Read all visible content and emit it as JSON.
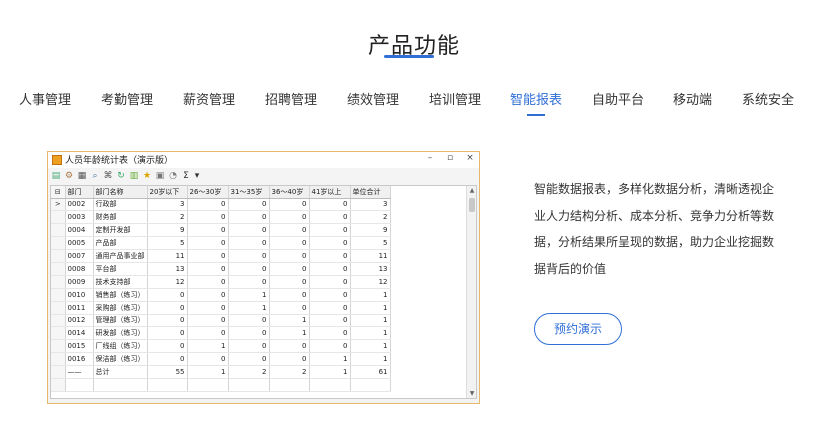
{
  "section": {
    "title": "产品功能"
  },
  "tabs": [
    {
      "label": "人事管理",
      "active": false
    },
    {
      "label": "考勤管理",
      "active": false
    },
    {
      "label": "薪资管理",
      "active": false
    },
    {
      "label": "招聘管理",
      "active": false
    },
    {
      "label": "绩效管理",
      "active": false
    },
    {
      "label": "培训管理",
      "active": false
    },
    {
      "label": "智能报表",
      "active": true
    },
    {
      "label": "自助平台",
      "active": false
    },
    {
      "label": "移动端",
      "active": false
    },
    {
      "label": "系统安全",
      "active": false
    }
  ],
  "window": {
    "title": "人员年龄统计表（演示版）",
    "controls": {
      "minimize": "–",
      "maximize": "▫",
      "close": "×"
    },
    "toolbar_icons": [
      "print-preview-icon",
      "setup-icon",
      "print-icon",
      "search-icon",
      "find-icon",
      "refresh-icon",
      "export-icon",
      "star-icon",
      "save-icon",
      "chat-icon",
      "sigma-icon",
      "dropdown-icon"
    ],
    "grid": {
      "columns": [
        "",
        "部门",
        "部门名称",
        "20岁以下",
        "26～30岁",
        "31～35岁",
        "36～40岁",
        "41岁以上",
        "单位合计"
      ],
      "header_indicator": "⊟",
      "rows": [
        {
          "ind": ">",
          "code": "0002",
          "name": "行政部",
          "v": [
            "3",
            "0",
            "0",
            "0",
            "0",
            "3"
          ]
        },
        {
          "ind": "",
          "code": "0003",
          "name": "财务部",
          "v": [
            "2",
            "0",
            "0",
            "0",
            "0",
            "2"
          ]
        },
        {
          "ind": "",
          "code": "0004",
          "name": "定制开发部",
          "v": [
            "9",
            "0",
            "0",
            "0",
            "0",
            "9"
          ]
        },
        {
          "ind": "",
          "code": "0005",
          "name": "产品部",
          "v": [
            "5",
            "0",
            "0",
            "0",
            "0",
            "5"
          ]
        },
        {
          "ind": "",
          "code": "0007",
          "name": "通用产品事业部",
          "v": [
            "11",
            "0",
            "0",
            "0",
            "0",
            "11"
          ]
        },
        {
          "ind": "",
          "code": "0008",
          "name": "平台部",
          "v": [
            "13",
            "0",
            "0",
            "0",
            "0",
            "13"
          ]
        },
        {
          "ind": "",
          "code": "0009",
          "name": "技术支持部",
          "v": [
            "12",
            "0",
            "0",
            "0",
            "0",
            "12"
          ]
        },
        {
          "ind": "",
          "code": "0010",
          "name": "销售部（练习）",
          "v": [
            "0",
            "0",
            "1",
            "0",
            "0",
            "1"
          ]
        },
        {
          "ind": "",
          "code": "0011",
          "name": "采购部（练习）",
          "v": [
            "0",
            "0",
            "1",
            "0",
            "0",
            "1"
          ]
        },
        {
          "ind": "",
          "code": "0012",
          "name": "管理部（练习）",
          "v": [
            "0",
            "0",
            "0",
            "1",
            "0",
            "1"
          ]
        },
        {
          "ind": "",
          "code": "0014",
          "name": "研发部（练习）",
          "v": [
            "0",
            "0",
            "0",
            "1",
            "0",
            "1"
          ]
        },
        {
          "ind": "",
          "code": "0015",
          "name": "厂线组（练习）",
          "v": [
            "0",
            "1",
            "0",
            "0",
            "0",
            "1"
          ]
        },
        {
          "ind": "",
          "code": "0016",
          "name": "保洁部（练习）",
          "v": [
            "0",
            "0",
            "0",
            "0",
            "1",
            "1"
          ]
        },
        {
          "ind": "",
          "code": "——",
          "name": "总计",
          "v": [
            "55",
            "1",
            "2",
            "2",
            "1",
            "61"
          ]
        }
      ]
    }
  },
  "description": "智能数据报表，多样化数据分析，清晰透视企业人力结构分析、成本分析、竞争力分析等数据，分析结果所呈现的数据，助力企业挖掘数据背后的价值",
  "demo_button": {
    "label": "预约演示"
  },
  "colors": {
    "accent": "#2f6fd6",
    "window_border": "#e8b86a"
  }
}
